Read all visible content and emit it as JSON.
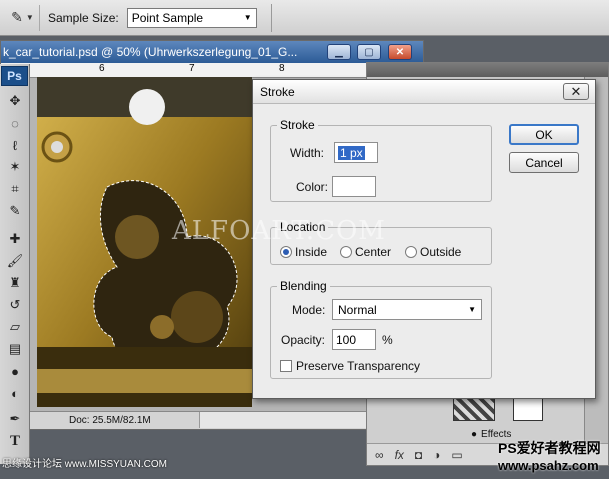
{
  "options_bar": {
    "tool_icon": "eyedropper-icon",
    "sample_size_label": "Sample Size:",
    "sample_size_value": "Point Sample"
  },
  "toolbox": {
    "logo": "Ps"
  },
  "document": {
    "title": "k_car_tutorial.psd @ 50% (Uhrwerkszerlegung_01_G...",
    "ruler_marks": [
      "6",
      "7",
      "8"
    ],
    "status": "Doc: 25.5M/82.1M"
  },
  "dialog": {
    "title": "Stroke",
    "stroke_group": "Stroke",
    "width_label": "Width:",
    "width_value": "1 px",
    "color_label": "Color:",
    "location_group": "Location",
    "location_options": [
      "Inside",
      "Center",
      "Outside"
    ],
    "location_selected": "Inside",
    "blending_group": "Blending",
    "mode_label": "Mode:",
    "mode_value": "Normal",
    "opacity_label": "Opacity:",
    "opacity_value": "100",
    "opacity_unit": "%",
    "preserve_label": "Preserve Transparency",
    "ok_label": "OK",
    "cancel_label": "Cancel"
  },
  "layers_panel": {
    "effects_label": "Effects"
  },
  "watermark": "ALFOART.COM",
  "credits": {
    "left": "思缘设计论坛 www.MISSYUAN.COM",
    "right_line1": "PS爱好者教程网",
    "right_line2": "www.psahz.com"
  }
}
